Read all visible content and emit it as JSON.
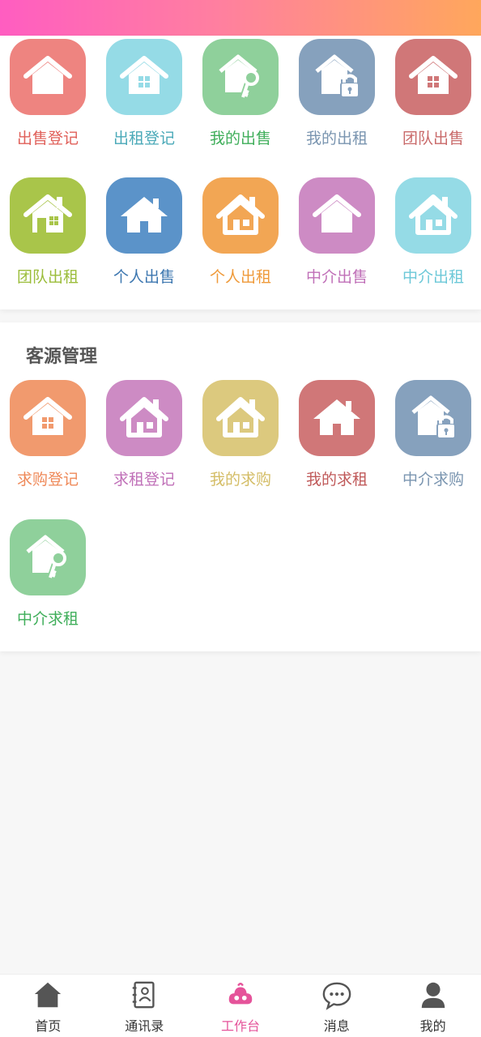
{
  "colors": {
    "header_gradient": [
      "#ff5dc1",
      "#ffa75c"
    ],
    "active_nav": "#e5539a",
    "nav_icon": "#555555"
  },
  "house_section": {
    "items": [
      {
        "label": "出售登记",
        "color": "#ee8480",
        "text_color": "#e0605a",
        "icon": "house-icon"
      },
      {
        "label": "出租登记",
        "color": "#95dbe6",
        "text_color": "#4aa9b8",
        "icon": "house-window-icon"
      },
      {
        "label": "我的出售",
        "color": "#8fd09b",
        "text_color": "#3fae5a",
        "icon": "house-key-icon"
      },
      {
        "label": "我的出租",
        "color": "#86a1bd",
        "text_color": "#7a95b0",
        "icon": "house-lock-icon"
      },
      {
        "label": "团队出售",
        "color": "#d07778",
        "text_color": "#c96a6a",
        "icon": "house-window-icon"
      },
      {
        "label": "团队出租",
        "color": "#a9c54a",
        "text_color": "#9bbd3a",
        "icon": "house-chimney-icon"
      },
      {
        "label": "个人出售",
        "color": "#5b93c9",
        "text_color": "#3d77b0",
        "icon": "house-solid-icon"
      },
      {
        "label": "个人出租",
        "color": "#f2a654",
        "text_color": "#ef9a3a",
        "icon": "house-outline-icon"
      },
      {
        "label": "中介出售",
        "color": "#cd8bc4",
        "text_color": "#c070b8",
        "icon": "house-icon"
      },
      {
        "label": "中介出租",
        "color": "#95dbe6",
        "text_color": "#6cc8d8",
        "icon": "house-outline-icon"
      }
    ]
  },
  "client_section": {
    "title": "客源管理",
    "items": [
      {
        "label": "求购登记",
        "color": "#f19a6e",
        "text_color": "#ef8a5a",
        "icon": "house-window-icon"
      },
      {
        "label": "求租登记",
        "color": "#cd8bc4",
        "text_color": "#c070b8",
        "icon": "house-outline-icon"
      },
      {
        "label": "我的求购",
        "color": "#dcc97e",
        "text_color": "#d4bd66",
        "icon": "house-outline-icon"
      },
      {
        "label": "我的求租",
        "color": "#d07778",
        "text_color": "#c05a5a",
        "icon": "house-solid-icon"
      },
      {
        "label": "中介求购",
        "color": "#86a1bd",
        "text_color": "#7a95b0",
        "icon": "house-lock-icon"
      },
      {
        "label": "中介求租",
        "color": "#8fd09b",
        "text_color": "#3fae5a",
        "icon": "house-key-icon"
      }
    ]
  },
  "bottom_nav": [
    {
      "label": "首页",
      "icon": "home-icon",
      "active": false
    },
    {
      "label": "通讯录",
      "icon": "contacts-icon",
      "active": false
    },
    {
      "label": "工作台",
      "icon": "workbench-icon",
      "active": true
    },
    {
      "label": "消息",
      "icon": "message-icon",
      "active": false
    },
    {
      "label": "我的",
      "icon": "profile-icon",
      "active": false
    }
  ]
}
